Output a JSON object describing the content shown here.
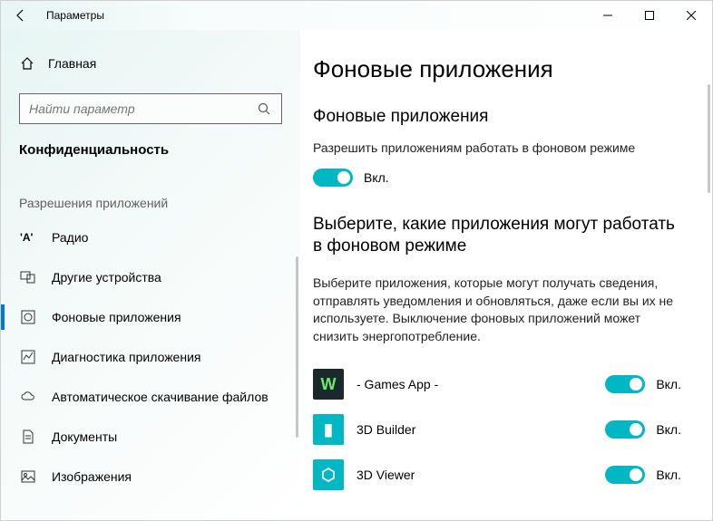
{
  "titlebar": {
    "title": "Параметры"
  },
  "sidebar": {
    "home": "Главная",
    "search_placeholder": "Найти параметр",
    "section": "Конфиденциальность",
    "subsection": "Разрешения приложений",
    "items": [
      {
        "label": "Радио"
      },
      {
        "label": "Другие устройства"
      },
      {
        "label": "Фоновые приложения",
        "active": true
      },
      {
        "label": "Диагностика приложения"
      },
      {
        "label": "Автоматическое скачивание файлов"
      },
      {
        "label": "Документы"
      },
      {
        "label": "Изображения"
      }
    ]
  },
  "main": {
    "h1": "Фоновые приложения",
    "h2a": "Фоновые приложения",
    "desc1": "Разрешить приложениям работать в фоновом режиме",
    "master_state": "Вкл.",
    "h2b": "Выберите, какие приложения могут работать в фоновом режиме",
    "desc2": "Выберите приложения, которые могут получать сведения, отправлять уведомления и обновляться, даже если вы их не используете. Выключение фоновых приложений может снизить энергопотребление.",
    "apps": [
      {
        "name": "- Games App -",
        "state": "Вкл.",
        "icon_bg": "#1a2a2a",
        "icon_letter": "W",
        "icon_color": "#6ee86e"
      },
      {
        "name": "3D Builder",
        "state": "Вкл.",
        "icon_bg": "#00b7c3",
        "icon_letter": "▮",
        "icon_color": "#ffffff"
      },
      {
        "name": "3D Viewer",
        "state": "Вкл.",
        "icon_bg": "#00b7c3",
        "icon_letter": "⬡",
        "icon_color": "#ffffff"
      }
    ]
  }
}
